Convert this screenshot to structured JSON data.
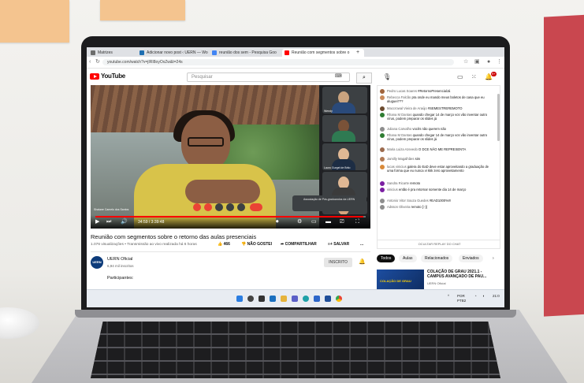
{
  "browser": {
    "tabs": [
      {
        "label": "Matrizes",
        "color": "#6d6d6d"
      },
      {
        "label": "Adicionar novo post ‹ UERN — Wo",
        "color": "#1f6fb2"
      },
      {
        "label": "reunião dos sem - Pesquisa Goo",
        "color": "#4285f4"
      },
      {
        "label": "Reunião com segmentos sobre o",
        "color": "#ff0000"
      }
    ],
    "new_tab": "+",
    "url": "youtube.com/watch?v=jIRI8oyOxZw&t=24s"
  },
  "youtube": {
    "logo_text": "YouTube",
    "search_placeholder": "Pesquisar",
    "notification_count": "9+"
  },
  "video": {
    "participants": [
      {
        "name": "Wendy",
        "face": "#c9a37f",
        "shirt": "#2a4a7a"
      },
      {
        "name": "",
        "face": "#7a5238",
        "shirt": "#2f7a52"
      },
      {
        "name": "Lauro Gurgel de Brito",
        "face": "#e0b894",
        "shirt": "#1d2d44"
      },
      {
        "name": "",
        "face": "#e0b894",
        "shirt": "#3b3b3b"
      },
      {
        "name": "",
        "face": "#d4a57e",
        "shirt": "#5b5b5b"
      }
    ],
    "speaker_label": "Shaiane Camelo dos Santos",
    "notice": "Associação de Pós-graduandos da UERN",
    "progress_fraction": 0.99,
    "timecode": "34:59 / 3:39:48"
  },
  "below": {
    "title": "Reunião com segmentos sobre o retorno das aulas presenciais",
    "meta": "1.076 visualizações • Transmissão ao vivo realizada há 6 horas",
    "likes": "466",
    "dislike_label": "NÃO GOSTEI",
    "share_label": "COMPARTILHAR",
    "save_label": "SALVAR",
    "more_label": "...",
    "channel_name": "UERN Oficial",
    "channel_avatar": "UERN",
    "channel_subs": "6,94 mil inscritos",
    "subscribe_label": "INSCRITO",
    "participants_label": "Participantes:"
  },
  "chat": {
    "messages": [
      {
        "author": "Pedro Lucas Soares",
        "text": "#RetornoPresencialJá",
        "color": "#a0643c"
      },
      {
        "author": "Rebecca Falcão",
        "text": "pra onde eu mando meus boletos de casa que eu aluguei???",
        "color": "#c98a5a"
      },
      {
        "author": "Maccrowal Vieira de Araújo",
        "text": "#SEMESTREREMOTO",
        "color": "#6b4a2f"
      },
      {
        "author": "Rhana M Dantas",
        "text": "quando chegar 14 de março vcs vão inventar outro vírus, podem preparar os slides já",
        "color": "#2e7d32"
      },
      {
        "author": "Juliana Carvalho",
        "text": "vocês não querem não",
        "color": "#8e8e8e"
      },
      {
        "author": "Rhana M Dantas",
        "text": "quando chegar 14 de março vcs vão inventar outro vírus, podem preparar os slides já",
        "color": "#2e7d32"
      },
      {
        "author": "Maria Luiza Azevedo",
        "text": "O DCE NÃO ME REPRESENTA",
        "color": "#9c6b4e"
      },
      {
        "author": "Jamilly Magalhães",
        "text": "sim",
        "color": "#b07a55"
      },
      {
        "author": "lucas vinicius",
        "text": "galera do EaD deve estar aproveitando a graduação de uma forma que eu nunca vi kkk zero aproveitamento",
        "color": "#d98a3a"
      },
      {
        "author": "Sandra Ricarte",
        "text": "remoto",
        "color": "#7b1fa2"
      },
      {
        "author": "vinicius",
        "text": "então é pra retornar somente dia 14 de março",
        "color": "#7b1fa2"
      },
      {
        "author": "Antonio Vitor Souza Guedes",
        "text": "#EAD1000%!!!",
        "color": "#8e8e8e"
      },
      {
        "author": "Adsson Oliveira",
        "text": "remoto [:-)]",
        "color": "#8e8e8e"
      }
    ],
    "footer_label": "OCULTAR REPLAY DO CHAT"
  },
  "recommendations": {
    "chips": [
      "Todos",
      "Aulas",
      "Relacionados",
      "Enviados"
    ],
    "items": [
      {
        "title": "COLAÇÃO DE GRAU 2021.1 - CAMPUS AVANÇADO DE PAU...",
        "channel": "UERN Oficial",
        "thumb_text": "COLAÇÃO DE GRAU"
      }
    ]
  },
  "taskbar": {
    "lang": "POR PTB2",
    "time": "21:0"
  }
}
